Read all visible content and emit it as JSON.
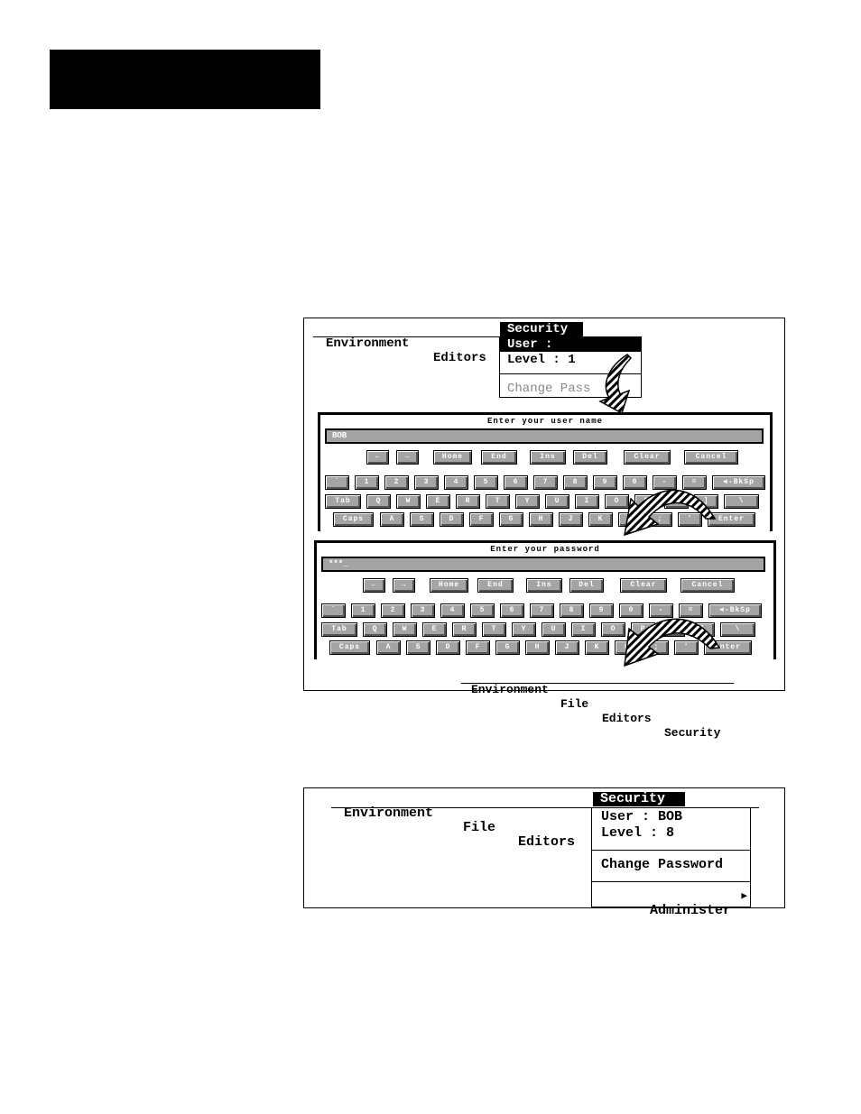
{
  "figure1": {
    "menubar": {
      "items": [
        "Environment",
        "Editors",
        "Security"
      ],
      "active": "Security"
    },
    "security_menu": {
      "user": "User :",
      "level": "Level : 1",
      "change_password": "Change Pass"
    },
    "keyboard_user": {
      "title": "Enter your user name",
      "value": "BOB",
      "nav_keys": [
        "←",
        "→",
        "Home",
        "End",
        "Ins",
        "Del",
        "Clear",
        "Cancel"
      ],
      "row1": [
        "`",
        "1",
        "2",
        "3",
        "4",
        "5",
        "6",
        "7",
        "8",
        "9",
        "0",
        "-",
        "=",
        "◄-BkSp"
      ],
      "row2": [
        "Tab",
        "Q",
        "W",
        "E",
        "R",
        "T",
        "Y",
        "U",
        "I",
        "O",
        "P",
        "[",
        "]",
        "\\"
      ],
      "row3": [
        "Caps",
        "A",
        "S",
        "D",
        "F",
        "G",
        "H",
        "J",
        "K",
        "L",
        ";",
        "'",
        "Enter"
      ]
    },
    "keyboard_password": {
      "title": "Enter your password",
      "value": "***_",
      "nav_keys": [
        "←",
        "→",
        "Home",
        "End",
        "Ins",
        "Del",
        "Clear",
        "Cancel"
      ],
      "row1": [
        "`",
        "1",
        "2",
        "3",
        "4",
        "5",
        "6",
        "7",
        "8",
        "9",
        "0",
        "-",
        "=",
        "◄-BkSp"
      ],
      "row2": [
        "Tab",
        "Q",
        "W",
        "E",
        "R",
        "T",
        "Y",
        "U",
        "I",
        "O",
        "P",
        "[",
        "]",
        "\\"
      ],
      "row3": [
        "Caps",
        "A",
        "S",
        "D",
        "F",
        "G",
        "H",
        "J",
        "K",
        "L",
        ";",
        "'",
        "Enter"
      ]
    },
    "bottom_menubar": {
      "items": [
        "Environment",
        "File",
        "Editors",
        "Security"
      ]
    }
  },
  "figure2": {
    "menubar": {
      "items": [
        "Environment",
        "File",
        "Editors",
        "Security"
      ],
      "active": "Security"
    },
    "security_menu": {
      "user": "User : BOB",
      "level": "Level : 8",
      "change_password": "Change Password",
      "administer": "Administer",
      "submenu_icon": "triangle-right-icon"
    }
  },
  "colors": {
    "key_fill": "#a4a4a4",
    "highlight": "#000000"
  }
}
